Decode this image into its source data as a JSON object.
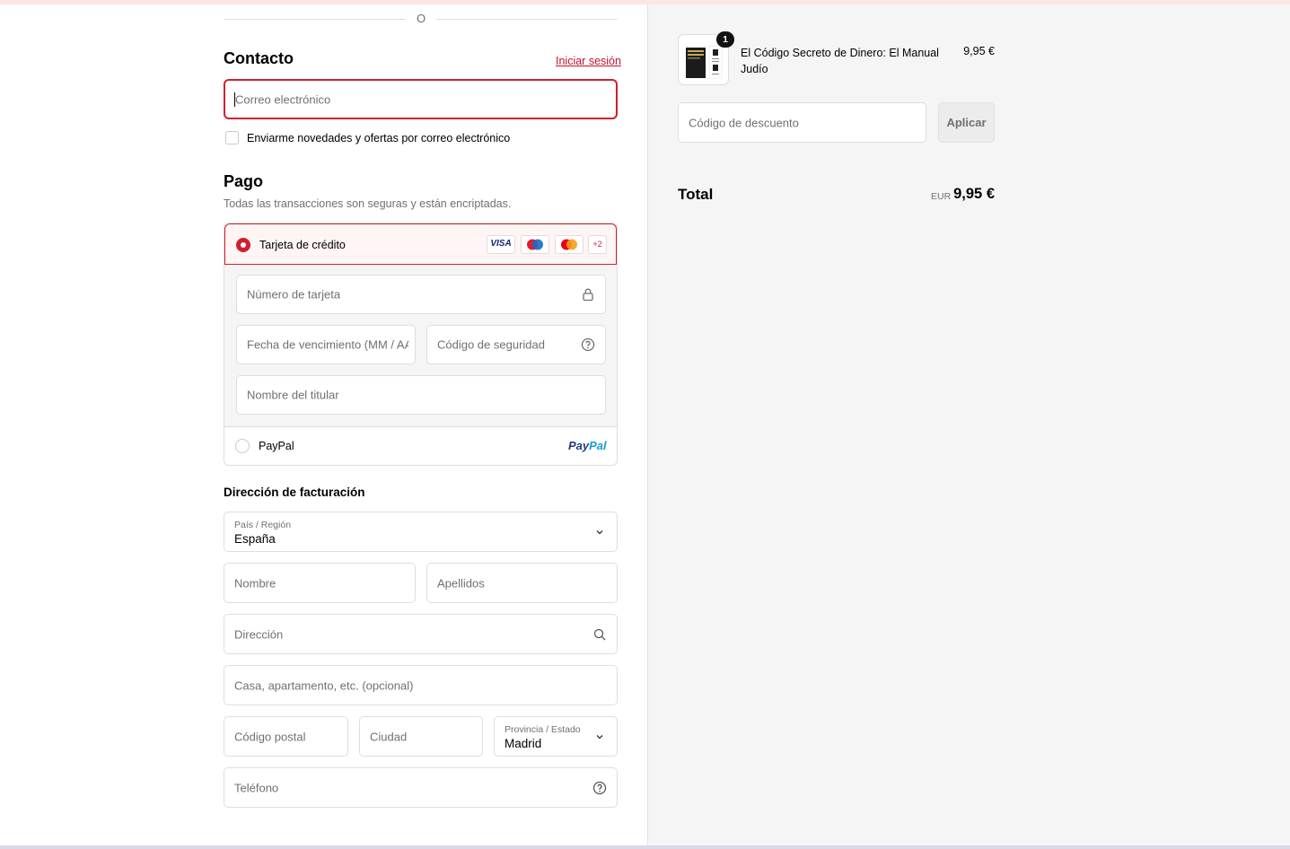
{
  "divider": {
    "text": "O"
  },
  "contact": {
    "title": "Contacto",
    "login_link": "Iniciar sesión",
    "email_placeholder": "Correo electrónico",
    "newsletter_label": "Enviarme novedades y ofertas por correo electrónico"
  },
  "payment": {
    "title": "Pago",
    "subtitle": "Todas las transacciones son seguras y están encriptadas.",
    "credit_card_label": "Tarjeta de crédito",
    "card_brands": [
      "VISA",
      "Maestro",
      "Mastercard"
    ],
    "more_brands": "+2",
    "card_number_placeholder": "Número de tarjeta",
    "expiry_placeholder": "Fecha de vencimiento (MM / AA)",
    "cvv_placeholder": "Código de seguridad",
    "holder_placeholder": "Nombre del titular",
    "paypal_label": "PayPal",
    "paypal_logo_a": "Pay",
    "paypal_logo_b": "Pal",
    "selected_method": "Tarjeta de crédito"
  },
  "billing": {
    "title": "Dirección de facturación",
    "country_label": "País / Región",
    "country_value": "España",
    "first_name_placeholder": "Nombre",
    "last_name_placeholder": "Apellidos",
    "address_placeholder": "Dirección",
    "apartment_placeholder": "Casa, apartamento, etc. (opcional)",
    "postal_placeholder": "Código postal",
    "city_placeholder": "Ciudad",
    "province_label": "Provincia / Estado",
    "province_value": "Madrid",
    "phone_placeholder": "Teléfono"
  },
  "summary": {
    "product_name": "El Código Secreto de Dinero: El Manual Judío",
    "product_price": "9,95 €",
    "quantity": "1",
    "discount_placeholder": "Código de descuento",
    "apply_label": "Aplicar",
    "total_label": "Total",
    "currency": "EUR",
    "total_value": "9,95 €"
  },
  "colors": {
    "accent": "#d01f2f",
    "link": "#c8102e",
    "panel_bg": "#f5f5f5",
    "paypal_dark": "#253b80",
    "paypal_light": "#179bd7"
  },
  "icons": [
    "lock-icon",
    "help-circle-icon",
    "chevron-down-icon",
    "search-icon",
    "book-cover-icon"
  ]
}
